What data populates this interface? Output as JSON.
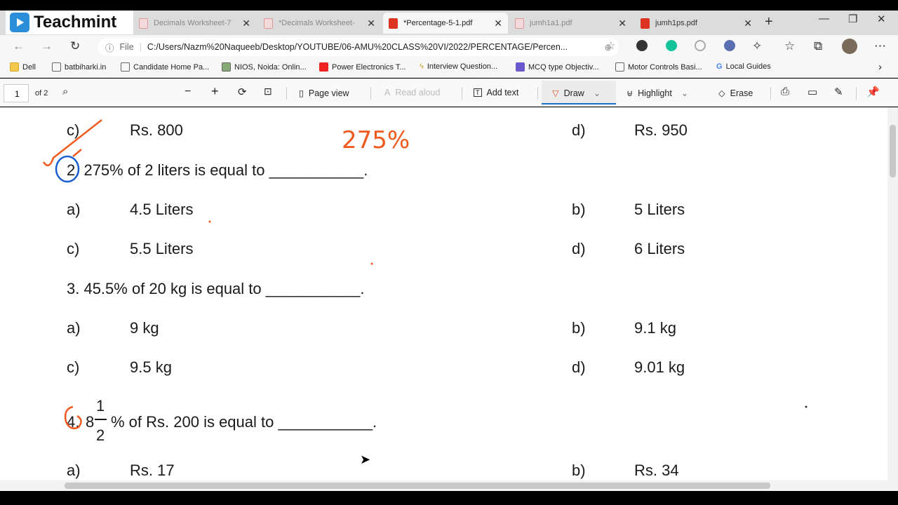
{
  "logo": {
    "text": "Teachmint"
  },
  "tabs": [
    {
      "label": "Decimals Worksheet-7",
      "active": false
    },
    {
      "label": "*Decimals Worksheet-",
      "active": false
    },
    {
      "label": "*Percentage-5-1.pdf",
      "active": true
    },
    {
      "label": "jumh1a1.pdf",
      "active": false
    },
    {
      "label": "jumh1ps.pdf",
      "active": false
    }
  ],
  "address": {
    "scheme": "File",
    "url": "C:/Users/Nazm%20Naqueeb/Desktop/YOUTUBE/06-AMU%20CLASS%20VI/2022/PERCENTAGE/Percen..."
  },
  "bookmarks": [
    "Dell",
    "batbiharki.in",
    "Candidate Home Pa...",
    "NIOS, Noida: Onlin...",
    "Power Electronics T...",
    "Interview Question...",
    "MCQ type Objectiv...",
    "Motor Controls Basi...",
    "Local Guides"
  ],
  "pdf_toolbar": {
    "page": "1",
    "of": "of 2",
    "page_view": "Page view",
    "read_aloud": "Read aloud",
    "add_text": "Add text",
    "draw": "Draw",
    "highlight": "Highlight",
    "erase": "Erase"
  },
  "document": {
    "q1_options": [
      {
        "letter": "c)",
        "value": "Rs. 800"
      },
      {
        "letter": "d)",
        "value": "Rs. 950"
      }
    ],
    "q2": {
      "text": "2. 275% of 2 liters is equal to ___________.",
      "options": [
        {
          "letter": "a)",
          "value": "4.5 Liters"
        },
        {
          "letter": "b)",
          "value": "5 Liters"
        },
        {
          "letter": "c)",
          "value": "5.5 Liters"
        },
        {
          "letter": "d)",
          "value": "6 Liters"
        }
      ]
    },
    "q3": {
      "text": "3. 45.5% of 20 kg is equal to ___________.",
      "options": [
        {
          "letter": "a)",
          "value": "9 kg"
        },
        {
          "letter": "b)",
          "value": "9.1 kg"
        },
        {
          "letter": "c)",
          "value": "9.5 kg"
        },
        {
          "letter": "d)",
          "value": "9.01 kg"
        }
      ]
    },
    "q4": {
      "num": "4.",
      "whole": "8",
      "numerator": "1",
      "denominator": "2",
      "rest": "% of Rs. 200 is equal to ___________.",
      "options": [
        {
          "letter": "a)",
          "value": "Rs. 17"
        },
        {
          "letter": "b)",
          "value": "Rs. 34"
        }
      ]
    }
  },
  "annotations": {
    "handwritten": "275%",
    "ink_orange": "#f05a1e",
    "ink_blue": "#1a5fd0"
  }
}
